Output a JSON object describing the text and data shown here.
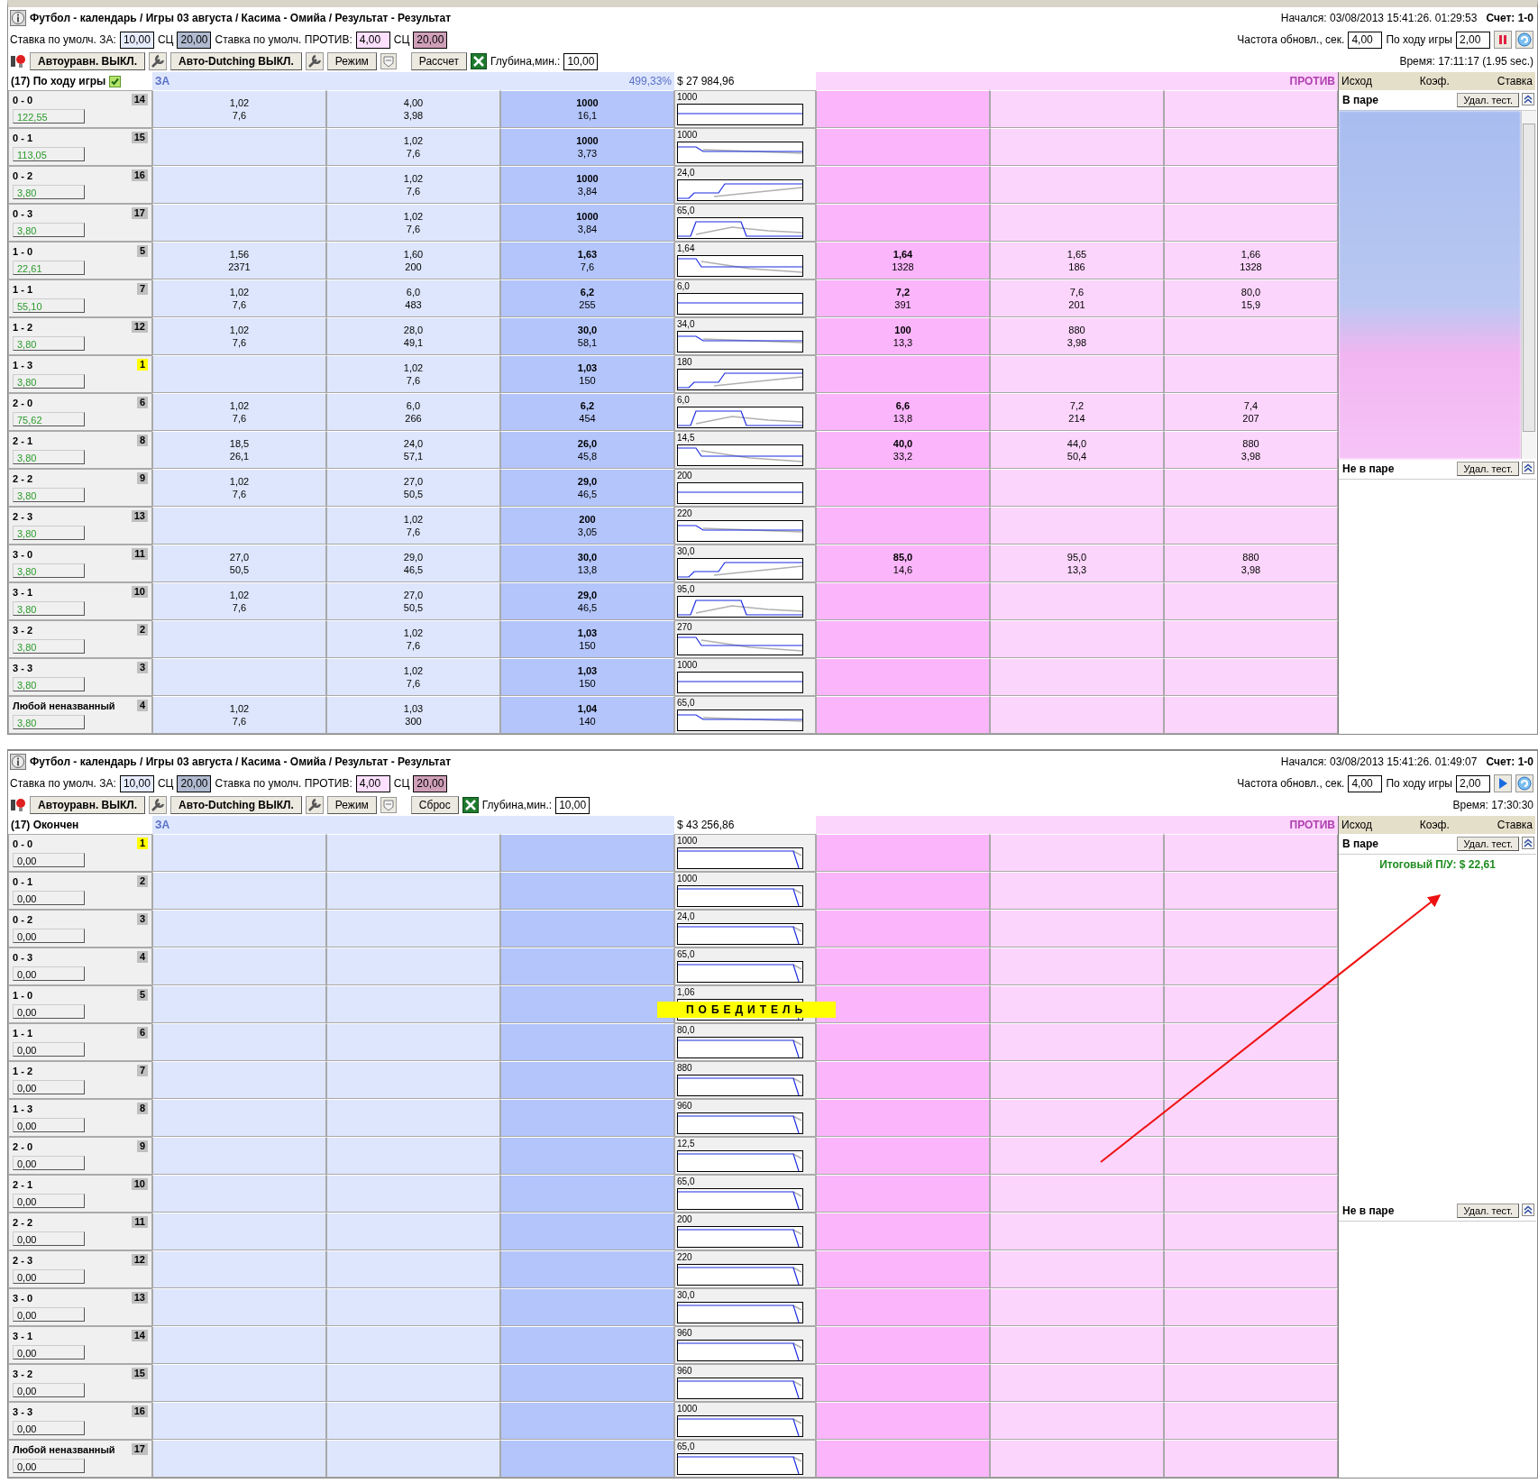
{
  "panels": [
    {
      "in_play": true,
      "arrow": false,
      "title": "Футбол - календарь / Игры 03 августа / Касима - Омийа / Результат - Результат",
      "started": "Начался: 03/08/2013 15:41:26. 01:29:53",
      "score": "Счет: 1-0",
      "stake_back_label": "Ставка по умолч. ЗА:",
      "stake_back": "10,00",
      "sc_back_label": "СЦ",
      "sc_back": "20,00",
      "stake_lay_label": "Ставка по умолч. ПРОТИВ:",
      "stake_lay": "4,00",
      "sc_lay_label": "СЦ",
      "sc_lay": "20,00",
      "refresh_label": "Частота обновл., сек.",
      "refresh": "4,00",
      "inplay_label": "По ходу игры",
      "inplay": "2,00",
      "toolbar": {
        "autobalance": "Автоуравн. ВЫКЛ.",
        "dutching": "Авто-Dutching ВЫКЛ.",
        "mode": "Режим",
        "action": "Рассчет",
        "depth_label": "Глубина,мин.:",
        "depth": "10,00"
      },
      "time": "Время: 17:11:17 (1.95 sec.)",
      "market": "(17) По ходу игры",
      "back_header": "ЗА",
      "back_percent": "499,33%",
      "total": "$ 27 984,96",
      "lay_header": "ПРОТИВ",
      "side_columns": [
        "Исход",
        "Коэф.",
        "Ставка"
      ],
      "matched": {
        "label": "В паре",
        "button": "Удал. тест."
      },
      "unmatched": {
        "label": "Не в паре",
        "button": "Удал. тест."
      },
      "rows": [
        {
          "score": "0 - 0",
          "rank": "14",
          "highlight": false,
          "pnl": "122,55",
          "chart_label": "1000",
          "back": {
            "third": {
              "price": "1,02",
              "size": "7,6"
            },
            "second": {
              "price": "4,00",
              "size": "3,98"
            },
            "best": {
              "price": "1000",
              "size": "16,1"
            }
          }
        },
        {
          "score": "0 - 1",
          "rank": "15",
          "highlight": false,
          "pnl": "113,05",
          "chart_label": "1000",
          "back": {
            "second": {
              "price": "1,02",
              "size": "7,6"
            },
            "best": {
              "price": "1000",
              "size": "3,73"
            }
          }
        },
        {
          "score": "0 - 2",
          "rank": "16",
          "highlight": false,
          "pnl": "3,80",
          "chart_label": "24,0",
          "back": {
            "second": {
              "price": "1,02",
              "size": "7,6"
            },
            "best": {
              "price": "1000",
              "size": "3,84"
            }
          }
        },
        {
          "score": "0 - 3",
          "rank": "17",
          "highlight": false,
          "pnl": "3,80",
          "chart_label": "65,0",
          "back": {
            "second": {
              "price": "1,02",
              "size": "7,6"
            },
            "best": {
              "price": "1000",
              "size": "3,84"
            }
          }
        },
        {
          "score": "1 - 0",
          "rank": "5",
          "highlight": false,
          "pnl": "22,61",
          "chart_label": "1,64",
          "back": {
            "third": {
              "price": "1,56",
              "size": "2371"
            },
            "second": {
              "price": "1,60",
              "size": "200"
            },
            "best": {
              "price": "1,63",
              "size": "7,6"
            }
          },
          "lay": {
            "best": {
              "price": "1,64",
              "size": "1328"
            },
            "second": {
              "price": "1,65",
              "size": "186"
            },
            "third": {
              "price": "1,66",
              "size": "1328"
            }
          }
        },
        {
          "score": "1 - 1",
          "rank": "7",
          "highlight": false,
          "pnl": "55,10",
          "chart_label": "6,0",
          "back": {
            "third": {
              "price": "1,02",
              "size": "7,6"
            },
            "second": {
              "price": "6,0",
              "size": "483"
            },
            "best": {
              "price": "6,2",
              "size": "255"
            }
          },
          "lay": {
            "best": {
              "price": "7,2",
              "size": "391"
            },
            "second": {
              "price": "7,6",
              "size": "201"
            },
            "third": {
              "price": "80,0",
              "size": "15,9"
            }
          }
        },
        {
          "score": "1 - 2",
          "rank": "12",
          "highlight": false,
          "pnl": "3,80",
          "chart_label": "34,0",
          "back": {
            "third": {
              "price": "1,02",
              "size": "7,6"
            },
            "second": {
              "price": "28,0",
              "size": "49,1"
            },
            "best": {
              "price": "30,0",
              "size": "58,1"
            }
          },
          "lay": {
            "best": {
              "price": "100",
              "size": "13,3"
            },
            "second": {
              "price": "880",
              "size": "3,98"
            }
          }
        },
        {
          "score": "1 - 3",
          "rank": "1",
          "highlight": true,
          "pnl": "3,80",
          "chart_label": "180",
          "back": {
            "second": {
              "price": "1,02",
              "size": "7,6"
            },
            "best": {
              "price": "1,03",
              "size": "150"
            }
          }
        },
        {
          "score": "2 - 0",
          "rank": "6",
          "highlight": false,
          "pnl": "75,62",
          "chart_label": "6,0",
          "back": {
            "third": {
              "price": "1,02",
              "size": "7,6"
            },
            "second": {
              "price": "6,0",
              "size": "266"
            },
            "best": {
              "price": "6,2",
              "size": "454"
            }
          },
          "lay": {
            "best": {
              "price": "6,6",
              "size": "13,8"
            },
            "second": {
              "price": "7,2",
              "size": "214"
            },
            "third": {
              "price": "7,4",
              "size": "207"
            }
          }
        },
        {
          "score": "2 - 1",
          "rank": "8",
          "highlight": false,
          "pnl": "3,80",
          "chart_label": "14,5",
          "back": {
            "third": {
              "price": "18,5",
              "size": "26,1"
            },
            "second": {
              "price": "24,0",
              "size": "57,1"
            },
            "best": {
              "price": "26,0",
              "size": "45,8"
            }
          },
          "lay": {
            "best": {
              "price": "40,0",
              "size": "33,2"
            },
            "second": {
              "price": "44,0",
              "size": "50,4"
            },
            "third": {
              "price": "880",
              "size": "3,98"
            }
          }
        },
        {
          "score": "2 - 2",
          "rank": "9",
          "highlight": false,
          "pnl": "3,80",
          "chart_label": "200",
          "back": {
            "third": {
              "price": "1,02",
              "size": "7,6"
            },
            "second": {
              "price": "27,0",
              "size": "50,5"
            },
            "best": {
              "price": "29,0",
              "size": "46,5"
            }
          }
        },
        {
          "score": "2 - 3",
          "rank": "13",
          "highlight": false,
          "pnl": "3,80",
          "chart_label": "220",
          "back": {
            "second": {
              "price": "1,02",
              "size": "7,6"
            },
            "best": {
              "price": "200",
              "size": "3,05"
            }
          }
        },
        {
          "score": "3 - 0",
          "rank": "11",
          "highlight": false,
          "pnl": "3,80",
          "chart_label": "30,0",
          "back": {
            "third": {
              "price": "27,0",
              "size": "50,5"
            },
            "second": {
              "price": "29,0",
              "size": "46,5"
            },
            "best": {
              "price": "30,0",
              "size": "13,8"
            }
          },
          "lay": {
            "best": {
              "price": "85,0",
              "size": "14,6"
            },
            "second": {
              "price": "95,0",
              "size": "13,3"
            },
            "third": {
              "price": "880",
              "size": "3,98"
            }
          }
        },
        {
          "score": "3 - 1",
          "rank": "10",
          "highlight": false,
          "pnl": "3,80",
          "chart_label": "95,0",
          "back": {
            "third": {
              "price": "1,02",
              "size": "7,6"
            },
            "second": {
              "price": "27,0",
              "size": "50,5"
            },
            "best": {
              "price": "29,0",
              "size": "46,5"
            }
          }
        },
        {
          "score": "3 - 2",
          "rank": "2",
          "highlight": false,
          "pnl": "3,80",
          "chart_label": "270",
          "back": {
            "second": {
              "price": "1,02",
              "size": "7,6"
            },
            "best": {
              "price": "1,03",
              "size": "150"
            }
          }
        },
        {
          "score": "3 - 3",
          "rank": "3",
          "highlight": false,
          "pnl": "3,80",
          "chart_label": "1000",
          "back": {
            "second": {
              "price": "1,02",
              "size": "7,6"
            },
            "best": {
              "price": "1,03",
              "size": "150"
            }
          }
        },
        {
          "score": "Любой неназванный",
          "rank": "4",
          "highlight": false,
          "pnl": "3,80",
          "chart_label": "65,0",
          "back": {
            "third": {
              "price": "1,02",
              "size": "7,6"
            },
            "second": {
              "price": "1,03",
              "size": "300"
            },
            "best": {
              "price": "1,04",
              "size": "140"
            }
          }
        }
      ]
    },
    {
      "in_play": false,
      "arrow": true,
      "title": "Футбол - календарь / Игры 03 августа / Касима - Омийа / Результат - Результат",
      "started": "Начался: 03/08/2013 15:41:26. 01:49:07",
      "score": "Счет: 1-0",
      "stake_back_label": "Ставка по умолч. ЗА:",
      "stake_back": "10,00",
      "sc_back_label": "СЦ",
      "sc_back": "20,00",
      "stake_lay_label": "Ставка по умолч. ПРОТИВ:",
      "stake_lay": "4,00",
      "sc_lay_label": "СЦ",
      "sc_lay": "20,00",
      "refresh_label": "Частота обновл., сек.",
      "refresh": "4,00",
      "inplay_label": "По ходу игры",
      "inplay": "2,00",
      "toolbar": {
        "autobalance": "Автоуравн. ВЫКЛ.",
        "dutching": "Авто-Dutching ВЫКЛ.",
        "mode": "Режим",
        "action": "Сброс",
        "depth_label": "Глубина,мин.:",
        "depth": "10,00"
      },
      "time": "Время: 17:30:30",
      "market": "(17) Окончен",
      "back_header": "ЗА",
      "total": "$ 43 256,86",
      "lay_header": "ПРОТИВ",
      "side_columns": [
        "Исход",
        "Коэф.",
        "Ставка"
      ],
      "matched": {
        "label": "В паре",
        "button": "Удал. тест.",
        "result": "Итоговый П/У: $ 22,61"
      },
      "unmatched": {
        "label": "Не в паре",
        "button": "Удал. тест."
      },
      "rows": [
        {
          "score": "0 - 0",
          "rank": "1",
          "highlight": true,
          "pnl": "0,00",
          "chart_label": "1000"
        },
        {
          "score": "0 - 1",
          "rank": "2",
          "highlight": false,
          "pnl": "0,00",
          "chart_label": "1000"
        },
        {
          "score": "0 - 2",
          "rank": "3",
          "highlight": false,
          "pnl": "0,00",
          "chart_label": "24,0"
        },
        {
          "score": "0 - 3",
          "rank": "4",
          "highlight": false,
          "pnl": "0,00",
          "chart_label": "65,0"
        },
        {
          "score": "1 - 0",
          "rank": "5",
          "highlight": false,
          "pnl": "0,00",
          "chart_label": "1,06",
          "banner": "ПОБЕДИТЕЛЬ"
        },
        {
          "score": "1 - 1",
          "rank": "6",
          "highlight": false,
          "pnl": "0,00",
          "chart_label": "80,0"
        },
        {
          "score": "1 - 2",
          "rank": "7",
          "highlight": false,
          "pnl": "0,00",
          "chart_label": "880"
        },
        {
          "score": "1 - 3",
          "rank": "8",
          "highlight": false,
          "pnl": "0,00",
          "chart_label": "960"
        },
        {
          "score": "2 - 0",
          "rank": "9",
          "highlight": false,
          "pnl": "0,00",
          "chart_label": "12,5"
        },
        {
          "score": "2 - 1",
          "rank": "10",
          "highlight": false,
          "pnl": "0,00",
          "chart_label": "65,0"
        },
        {
          "score": "2 - 2",
          "rank": "11",
          "highlight": false,
          "pnl": "0,00",
          "chart_label": "200"
        },
        {
          "score": "2 - 3",
          "rank": "12",
          "highlight": false,
          "pnl": "0,00",
          "chart_label": "220"
        },
        {
          "score": "3 - 0",
          "rank": "13",
          "highlight": false,
          "pnl": "0,00",
          "chart_label": "30,0"
        },
        {
          "score": "3 - 1",
          "rank": "14",
          "highlight": false,
          "pnl": "0,00",
          "chart_label": "960"
        },
        {
          "score": "3 - 2",
          "rank": "15",
          "highlight": false,
          "pnl": "0,00",
          "chart_label": "960"
        },
        {
          "score": "3 - 3",
          "rank": "16",
          "highlight": false,
          "pnl": "0,00",
          "chart_label": "1000"
        },
        {
          "score": "Любой неназванный",
          "rank": "17",
          "highlight": false,
          "pnl": "0,00",
          "chart_label": "65,0"
        }
      ]
    }
  ]
}
